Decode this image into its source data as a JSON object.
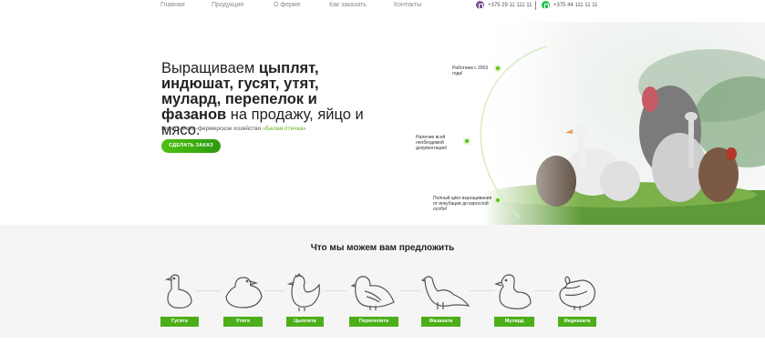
{
  "nav": {
    "items": [
      "Главная",
      "Продукция",
      "О ферме",
      "Как заказать",
      "Контакты"
    ],
    "phone1": "+375 29 11 111 11",
    "phone2": "+375 44  111 11 11"
  },
  "hero": {
    "title_part1": "Выращиваем ",
    "title_bold": "цыплят, индюшат, гусят, утят, мулард, перепелок и фазанов",
    "title_part2": " на продажу, яйцо и мясо.",
    "subtitle_prefix": "Крестьянско-фермерское хозяйство ",
    "subtitle_brand": "«Белая птичка»",
    "cta": "СДЕЛАТЬ ЗАКАЗ",
    "facts": [
      "Работаем с 2003 года!",
      "Наличие всей необходимой документации!",
      "Полный цикл выращивания от инкубации до взрослой особи!"
    ]
  },
  "offer": {
    "title": "Что мы можем вам предложить",
    "birds": [
      {
        "label": "Гусята",
        "icon": "gosling-icon"
      },
      {
        "label": "Утята",
        "icon": "duckling-icon"
      },
      {
        "label": "Цыплята",
        "icon": "chick-icon"
      },
      {
        "label": "Перепелята",
        "icon": "quail-icon"
      },
      {
        "label": "Фазаната",
        "icon": "pheasant-icon"
      },
      {
        "label": "Мулард",
        "icon": "mulard-icon"
      },
      {
        "label": "Индюшата",
        "icon": "turkey-icon"
      }
    ]
  },
  "colors": {
    "accent": "#4caf1a",
    "viber": "#7b519d",
    "whatsapp": "#27c24c"
  }
}
